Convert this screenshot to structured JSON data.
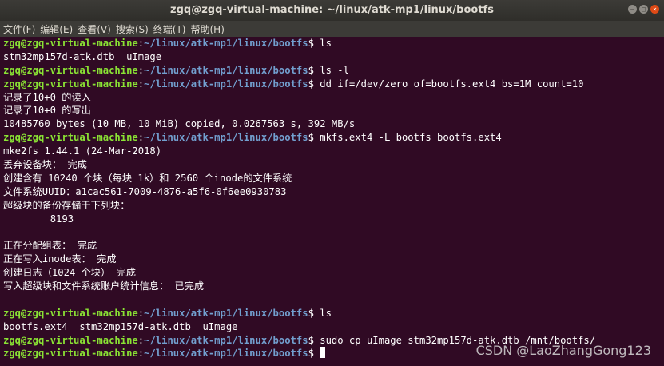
{
  "window": {
    "title": "zgq@zgq-virtual-machine: ~/linux/atk-mp1/linux/bootfs"
  },
  "menu": [
    "文件(F)",
    "编辑(E)",
    "查看(V)",
    "搜索(S)",
    "终端(T)",
    "帮助(H)"
  ],
  "prompt": {
    "user_host": "zgq@zgq-virtual-machine",
    "sep": ":",
    "path": "~/linux/atk-mp1/linux/bootfs",
    "dollar": "$ "
  },
  "lines": [
    {
      "p": true,
      "t": "ls"
    },
    {
      "p": false,
      "t": "stm32mp157d-atk.dtb  uImage"
    },
    {
      "p": true,
      "t": "ls -l"
    },
    {
      "p": true,
      "t": "dd if=/dev/zero of=bootfs.ext4 bs=1M count=10"
    },
    {
      "p": false,
      "t": "记录了10+0 的读入"
    },
    {
      "p": false,
      "t": "记录了10+0 的写出"
    },
    {
      "p": false,
      "t": "10485760 bytes (10 MB, 10 MiB) copied, 0.0267563 s, 392 MB/s"
    },
    {
      "p": true,
      "t": "mkfs.ext4 -L bootfs bootfs.ext4"
    },
    {
      "p": false,
      "t": "mke2fs 1.44.1 (24-Mar-2018)"
    },
    {
      "p": false,
      "t": "丢弃设备块： 完成"
    },
    {
      "p": false,
      "t": "创建含有 10240 个块（每块 1k）和 2560 个inode的文件系统"
    },
    {
      "p": false,
      "t": "文件系统UUID：a1cac561-7009-4876-a5f6-0f6ee0930783"
    },
    {
      "p": false,
      "t": "超级块的备份存储于下列块："
    },
    {
      "p": false,
      "t": "        8193"
    },
    {
      "p": false,
      "t": ""
    },
    {
      "p": false,
      "t": "正在分配组表： 完成"
    },
    {
      "p": false,
      "t": "正在写入inode表： 完成"
    },
    {
      "p": false,
      "t": "创建日志（1024 个块） 完成"
    },
    {
      "p": false,
      "t": "写入超级块和文件系统账户统计信息： 已完成"
    },
    {
      "p": false,
      "t": ""
    },
    {
      "p": true,
      "t": "ls"
    },
    {
      "p": false,
      "t": "bootfs.ext4  stm32mp157d-atk.dtb  uImage"
    },
    {
      "p": true,
      "t": "sudo cp uImage stm32mp157d-atk.dtb /mnt/bootfs/"
    },
    {
      "p": true,
      "t": "",
      "cursor": true
    }
  ],
  "watermark": "CSDN @LaoZhangGong123",
  "colors": {
    "background": "#300a24",
    "prompt_user": "#8ae234",
    "prompt_path": "#729fcf",
    "text": "#ffffff"
  }
}
